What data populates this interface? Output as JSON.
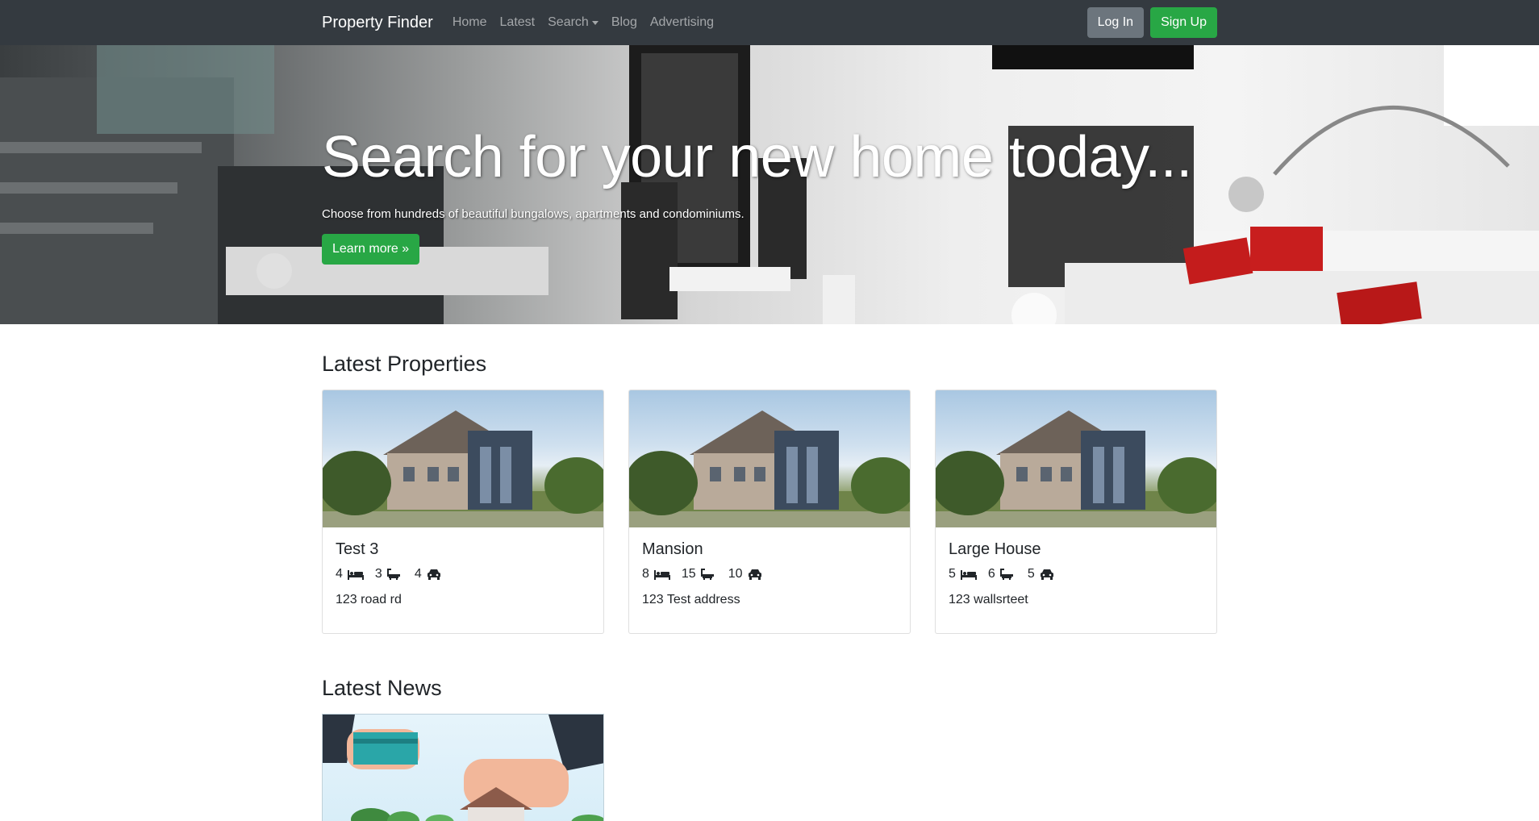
{
  "navbar": {
    "brand": "Property Finder",
    "links": [
      "Home",
      "Latest",
      "Search",
      "Blog",
      "Advertising"
    ],
    "login": "Log In",
    "signup": "Sign Up"
  },
  "hero": {
    "title": "Search for your new home today...",
    "subtitle": "Choose from hundreds of beautiful bungalows, apartments and condominiums.",
    "button": "Learn more »"
  },
  "latest": {
    "heading": "Latest Properties",
    "cards": [
      {
        "title": "Test 3",
        "beds": "4",
        "baths": "3",
        "garages": "4",
        "address": "123 road rd"
      },
      {
        "title": "Mansion",
        "beds": "8",
        "baths": "15",
        "garages": "10",
        "address": "123 Test address"
      },
      {
        "title": "Large House",
        "beds": "5",
        "baths": "6",
        "garages": "5",
        "address": "123 wallsrteet"
      }
    ]
  },
  "news": {
    "heading": "Latest News"
  },
  "icons": {
    "bed": "bed-icon",
    "bath": "bath-icon",
    "car": "car-icon",
    "caret": "caret-down-icon"
  },
  "colors": {
    "navbar": "#343a40",
    "success": "#28a745",
    "secondary": "#6c757d"
  }
}
